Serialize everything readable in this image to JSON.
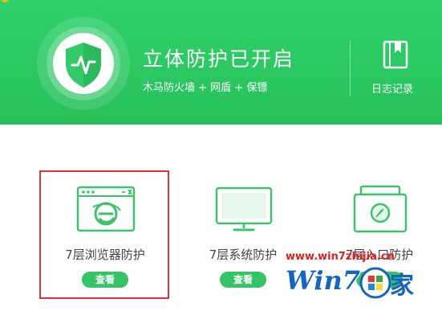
{
  "header": {
    "title": "立体防护已开启",
    "subtitle": "木马防火墙 + 网盾 + 保镖",
    "log_label": "日志记录"
  },
  "features": [
    {
      "label": "7层浏览器防护",
      "button": "查看",
      "icon": "browser-icon"
    },
    {
      "label": "7层系统防护",
      "button": "查看",
      "icon": "monitor-icon"
    },
    {
      "label": "7层入口防护",
      "button": "查看",
      "icon": "entry-icon"
    }
  ],
  "watermark": {
    "url": "www.win7zhijia.cn",
    "logo_text": "Win7",
    "logo_cn": "家"
  },
  "colors": {
    "header_green": "#2bc862",
    "button_green": "#35c366",
    "highlight_red": "#d93636",
    "watermark_blue": "#1565c0"
  }
}
